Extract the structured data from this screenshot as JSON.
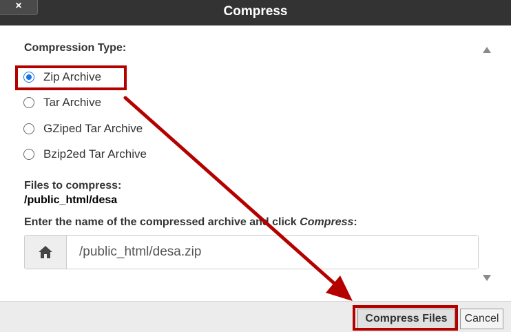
{
  "dialog": {
    "title": "Compress",
    "close_label": "×"
  },
  "compression": {
    "type_label": "Compression Type:",
    "options": [
      {
        "label": "Zip Archive",
        "checked": true
      },
      {
        "label": "Tar Archive",
        "checked": false
      },
      {
        "label": "GZiped Tar Archive",
        "checked": false
      },
      {
        "label": "Bzip2ed Tar Archive",
        "checked": false
      }
    ]
  },
  "files": {
    "label": "Files to compress:",
    "path": "/public_html/desa"
  },
  "archive": {
    "instruction_prefix": "Enter the name of the compressed archive and click ",
    "instruction_emphasis": "Compress",
    "instruction_suffix": ":",
    "value": "/public_html/desa.zip",
    "icon": "home-icon"
  },
  "footer": {
    "compress_label": "Compress Files",
    "cancel_label": "Cancel"
  },
  "annotation": {
    "color": "#b50000"
  },
  "colors": {
    "titlebar": "#333333",
    "radio_accent": "#1a73e8"
  }
}
